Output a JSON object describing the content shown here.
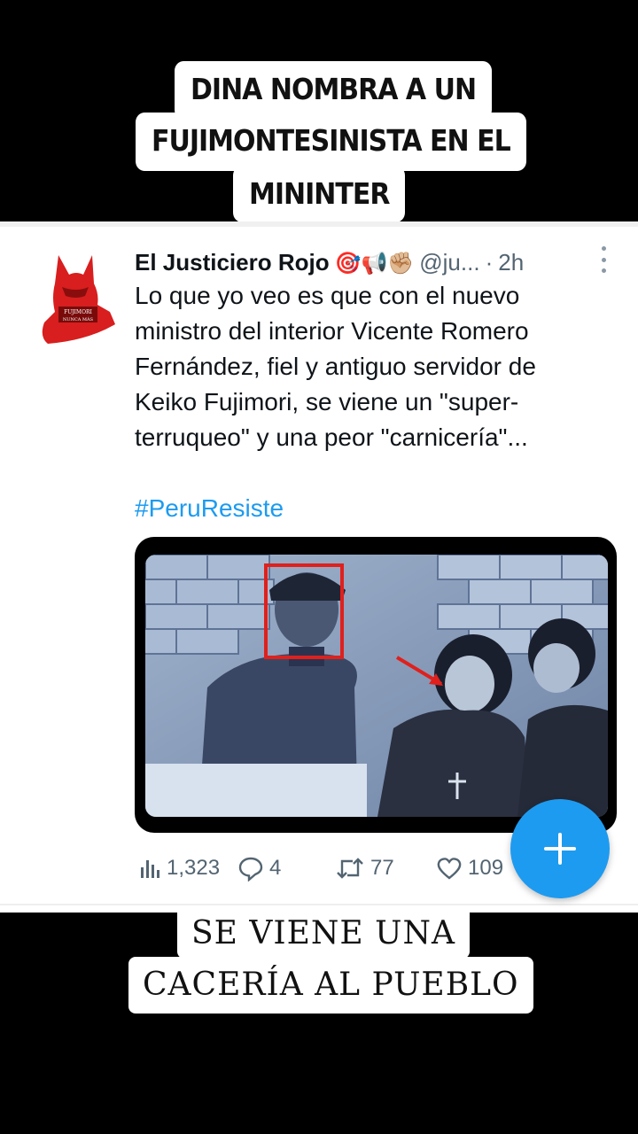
{
  "top_caption": {
    "line1": "DINA NOMBRA A UN",
    "line2": "FUJIMONTESINISTA EN EL",
    "line3": "MININTER"
  },
  "tweet": {
    "author": "El Justiciero Rojo",
    "emojis": "🎯📢✊🏼",
    "handle": "@ju...",
    "separator": "·",
    "time": "2h",
    "avatar_text": "FUJIMORI NUNCA MÁS",
    "body_lines": [
      "Lo que yo veo es que con el nuevo",
      "ministro del interior Vicente Romero",
      "Fernández, fiel y antiguo servidor de",
      "Keiko Fujimori, se viene un \"super-",
      "terruqueo\" y una peor \"carnicería\"..."
    ],
    "hashtag": "#PeruResiste",
    "stats": {
      "views": "1,323",
      "replies": "4",
      "retweets": "77",
      "likes": "109"
    },
    "colors": {
      "link": "#1d9bf0",
      "muted": "#536471",
      "accent": "#1d9bf0"
    }
  },
  "bottom_caption": {
    "line1": "SE VIENE UNA",
    "line2": "CACERÍA AL PUEBLO"
  }
}
